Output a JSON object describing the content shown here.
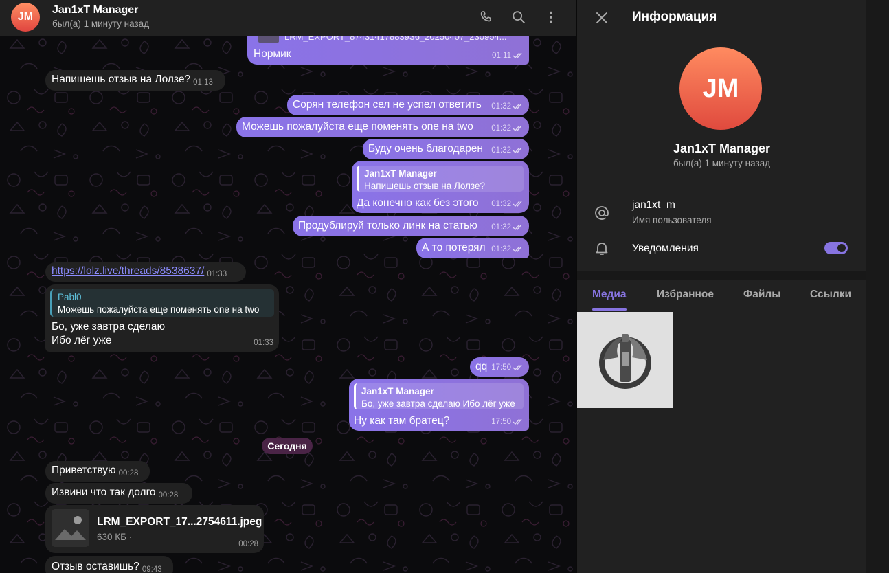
{
  "chat": {
    "header": {
      "avatar_initials": "JM",
      "name": "Jan1xT Manager",
      "status": "был(а) 1 минуту назад"
    },
    "date_separator": "Сегодня",
    "messages": [
      {
        "direction": "out",
        "text": "Нормик",
        "time": "01:11",
        "attachment_name": "LRM_EXPORT_874314178839З6_20250407_230954..."
      },
      {
        "direction": "in",
        "text": "Напишешь отзыв на Лолзе?",
        "time": "01:13"
      },
      {
        "direction": "out",
        "text": "Сорян телефон сел не успел ответить",
        "time": "01:32"
      },
      {
        "direction": "out",
        "text": "Можешь  пожалуйста еще поменять one на two",
        "time": "01:32"
      },
      {
        "direction": "out",
        "text": "Буду очень благодарен",
        "time": "01:32"
      },
      {
        "direction": "out",
        "reply_name": "Jan1xT Manager",
        "reply_text": "Напишешь отзыв на Лолзе?",
        "text": "Да конечно как без этого",
        "time": "01:32"
      },
      {
        "direction": "out",
        "text": "Продублируй только линк на статью",
        "time": "01:32"
      },
      {
        "direction": "out",
        "text": "А то потерял",
        "time": "01:32"
      },
      {
        "direction": "in",
        "text": "https://lolz.live/threads/8538637/",
        "time": "01:33"
      },
      {
        "direction": "in",
        "reply_name": "Pabl0",
        "reply_text": "Можешь пожалуйста еще поменять one на two",
        "text_line1": "Бо, уже завтра сделаю",
        "text_line2": "Ибо лёг уже",
        "time": "01:33"
      },
      {
        "direction": "out",
        "text": "qq",
        "time": "17:50"
      },
      {
        "direction": "out",
        "reply_name": "Jan1xT Manager",
        "reply_text": "Бо, уже завтра сделаю Ибо лёг уже",
        "text": "Ну как там братец?",
        "time": "17:50"
      },
      {
        "direction": "in",
        "text": "Приветствую",
        "time": "00:28"
      },
      {
        "direction": "in",
        "text": "Извини что так долго",
        "time": "00:28"
      },
      {
        "direction": "in",
        "file_name": "LRM_EXPORT_17...2754611.jpeg",
        "file_size": "630 КБ ·",
        "time": "00:28"
      },
      {
        "direction": "in",
        "text": "Отзыв оставишь?",
        "time": "09:43"
      }
    ]
  },
  "info": {
    "title": "Информация",
    "avatar_initials": "JM",
    "name": "Jan1xT Manager",
    "status": "был(а) 1 минуту назад",
    "username": "jan1xt_m",
    "username_label": "Имя пользователя",
    "notifications_label": "Уведомления",
    "notifications_on": true,
    "tabs": [
      "Медиа",
      "Избранное",
      "Файлы",
      "Ссылки"
    ],
    "active_tab": "Медиа"
  },
  "colors": {
    "accent": "#8774e1",
    "outgoing_bubble": "#8a73e8",
    "incoming_bubble": "#212121",
    "avatar_gradient": [
      "#ff8b60",
      "#e04a3e"
    ]
  },
  "icons": [
    "phone-icon",
    "search-icon",
    "more-vertical-icon",
    "close-icon",
    "at-icon",
    "bell-icon",
    "double-check-icon"
  ]
}
